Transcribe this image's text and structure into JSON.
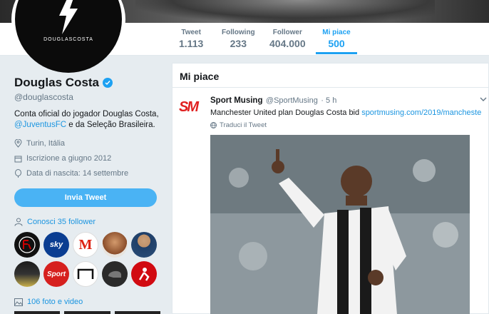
{
  "profile": {
    "avatar_text": "DOUGLASCOSTA",
    "name": "Douglas Costa",
    "handle": "@douglascosta",
    "bio_line1": "Conta oficial do jogador Douglas Costa,",
    "bio_mention": "@JuventusFC",
    "bio_line2": " e da Seleção Brasileira.",
    "location": "Turin, Itália",
    "joined": "Iscrizione a giugno 2012",
    "birthday": "Data di nascita: 14 settembre",
    "tweet_button": "Invia Tweet",
    "followers_you_know": "Conosci 35 follower",
    "photos_videos": "106 foto e video"
  },
  "nav": {
    "stats": [
      {
        "label": "Tweet",
        "value": "1.113"
      },
      {
        "label": "Following",
        "value": "233"
      },
      {
        "label": "Follower",
        "value": "404.000"
      },
      {
        "label": "Mi piace",
        "value": "500"
      }
    ]
  },
  "follower_grid": [
    {
      "icon": "flamengo-avatar",
      "text": "",
      "bg": "#111111"
    },
    {
      "icon": "sky-sport-avatar",
      "text": "sky",
      "bg": "#0a3d91"
    },
    {
      "icon": "marca-avatar",
      "text": "M",
      "bg": "#ffffff"
    },
    {
      "icon": "person-avatar",
      "text": "",
      "bg": "#b06a3b"
    },
    {
      "icon": "person-avatar",
      "text": "",
      "bg": "#2b4f7a"
    },
    {
      "icon": "player-avatar",
      "text": "",
      "bg": "#1d1d1d"
    },
    {
      "icon": "sport-bild-avatar",
      "text": "Sport",
      "bg": "#d6201e"
    },
    {
      "icon": "goal-avatar",
      "text": "",
      "bg": "#ffffff"
    },
    {
      "icon": "helmet-avatar",
      "text": "",
      "bg": "#2a2a2a"
    },
    {
      "icon": "bundesliga-avatar",
      "text": "",
      "bg": "#d10a11"
    }
  ],
  "timeline": {
    "title": "Mi piace",
    "tweet": {
      "logo": "SM",
      "name": "Sport Musing",
      "handle": "@SportMusing",
      "time": "· 5 h",
      "text": "Manchester United plan Douglas Costa bid ",
      "link": "sportmusing.com/2019/mancheste...",
      "translate": "Traduci il Tweet"
    }
  },
  "colors": {
    "accent": "#1da1f2",
    "background": "#e6ecf0",
    "logo_red": "#e02020"
  }
}
